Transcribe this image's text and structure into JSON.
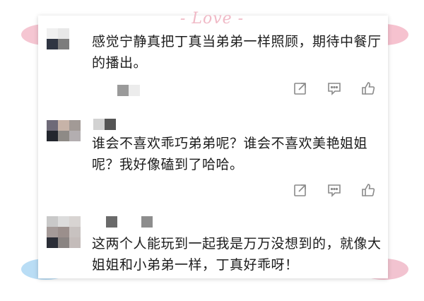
{
  "decor": {
    "love_label": "- Love -"
  },
  "comments": [
    {
      "text": "感觉宁静真把丁真当弟弟一样照顾，期待中餐厅的播出。",
      "actions": {
        "share_icon": "share-icon",
        "comment_icon": "comment-icon",
        "like_icon": "like-icon"
      }
    },
    {
      "text": "谁会不喜欢乖巧弟弟呢？谁会不喜欢美艳姐姐呢？我好像磕到了哈哈。",
      "actions": {
        "share_icon": "share-icon",
        "comment_icon": "comment-icon",
        "like_icon": "like-icon"
      }
    },
    {
      "text": "这两个人能玩到一起我是万万没想到的，就像大姐姐和小弟弟一样，丁真好乖呀！"
    }
  ],
  "colors": {
    "icon": "#8a8a8a",
    "text": "#1c1c1c",
    "ribbon_pink": "#f5c6d2",
    "ribbon_blue": "#b9ddf5"
  }
}
